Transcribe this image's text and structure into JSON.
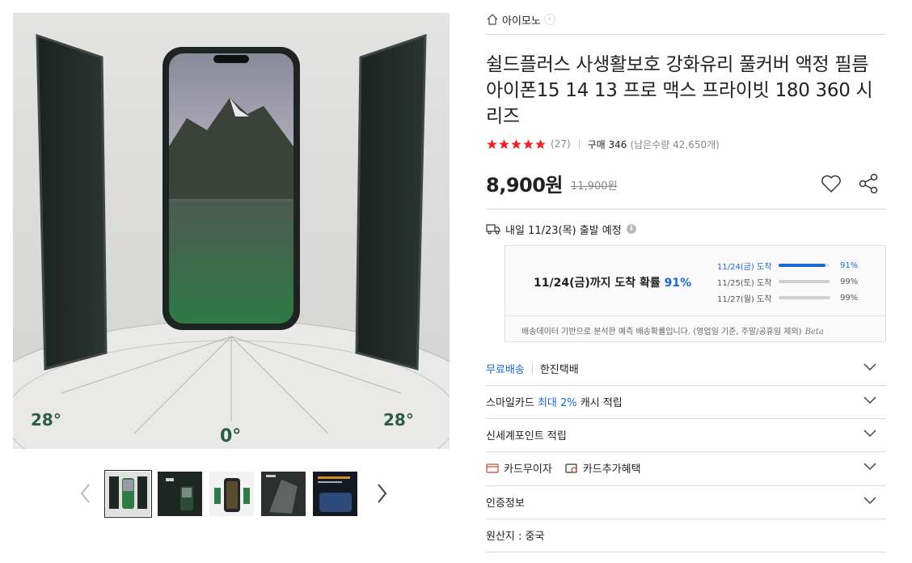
{
  "gallery": {
    "main_image_caption_left": "28°",
    "main_image_caption_center": "0°",
    "main_image_caption_right": "28°",
    "thumbnails": [
      "thumb-1",
      "thumb-2",
      "thumb-3",
      "thumb-4",
      "thumb-5"
    ],
    "selected_index": 0
  },
  "shop": {
    "name": "아이모노"
  },
  "product": {
    "title": "쉴드플러스 사생활보호 강화유리 풀커버 액정 필름 아이폰15 14 13 프로 맥스 프라이빗 180 360 시리즈",
    "rating_stars": 5,
    "review_count": "(27)",
    "purchase": "구매 346",
    "remaining": "(남은수량 42,650개)",
    "price": "8,900원",
    "original_price": "11,900원"
  },
  "shipping": {
    "departure": "내일 11/23(목) 출발 예정",
    "info_icon": "i",
    "prob_headline_prefix": "11/24(금)까지 도착 확률",
    "prob_headline_value": "91%",
    "prob_rows": [
      {
        "date": "11/24(금) 도착",
        "pct": "91%",
        "value": 0.91
      },
      {
        "date": "11/25(토) 도착",
        "pct": "99%",
        "value": 0.99
      },
      {
        "date": "11/27(월) 도착",
        "pct": "99%",
        "value": 0.99
      }
    ],
    "footnote": "배송데이터 기반으로 분석한 예측 배송확률입니다. (영업일 기준, 주말/공휴일 제외)",
    "beta": "Beta"
  },
  "accordion": {
    "free_shipping": "무료배송",
    "courier": "한진택배",
    "smile_prefix": "스마일카드",
    "smile_blue": "최대 2%",
    "smile_suffix": "캐시 적립",
    "shinsegae": "신세계포인트 적립",
    "card_interest": "카드무이자",
    "card_benefit": "카드추가혜택",
    "certification": "인증정보",
    "origin": "원산지 : 중국"
  },
  "colors": {
    "accent": "#1a68d6",
    "star": "#f0232b"
  }
}
